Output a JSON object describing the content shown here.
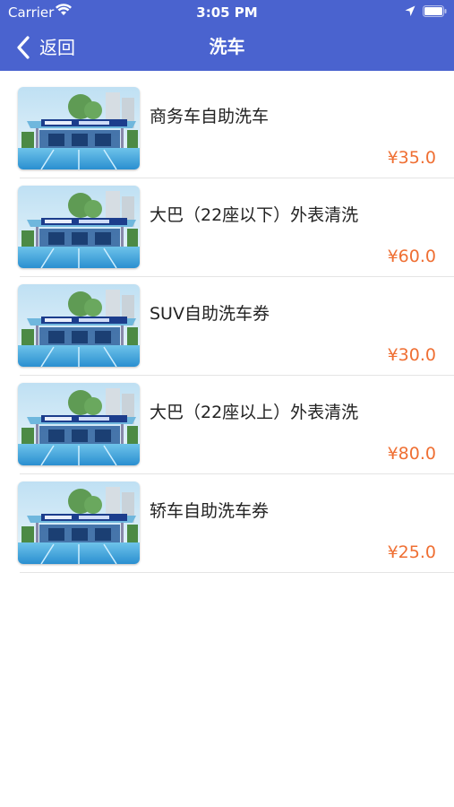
{
  "status_bar": {
    "carrier": "Carrier",
    "time": "3:05 PM"
  },
  "nav": {
    "back_label": "返回",
    "title": "洗车",
    "bar_color": "#4a63cf"
  },
  "colors": {
    "price": "#ef6f33"
  },
  "products": [
    {
      "name": "商务车自助洗车",
      "price": "¥35.0"
    },
    {
      "name": "大巴（22座以下）外表清洗",
      "price": "¥60.0"
    },
    {
      "name": "SUV自助洗车券",
      "price": "¥30.0"
    },
    {
      "name": "大巴（22座以上）外表清洗",
      "price": "¥80.0"
    },
    {
      "name": "轿车自助洗车券",
      "price": "¥25.0"
    }
  ]
}
